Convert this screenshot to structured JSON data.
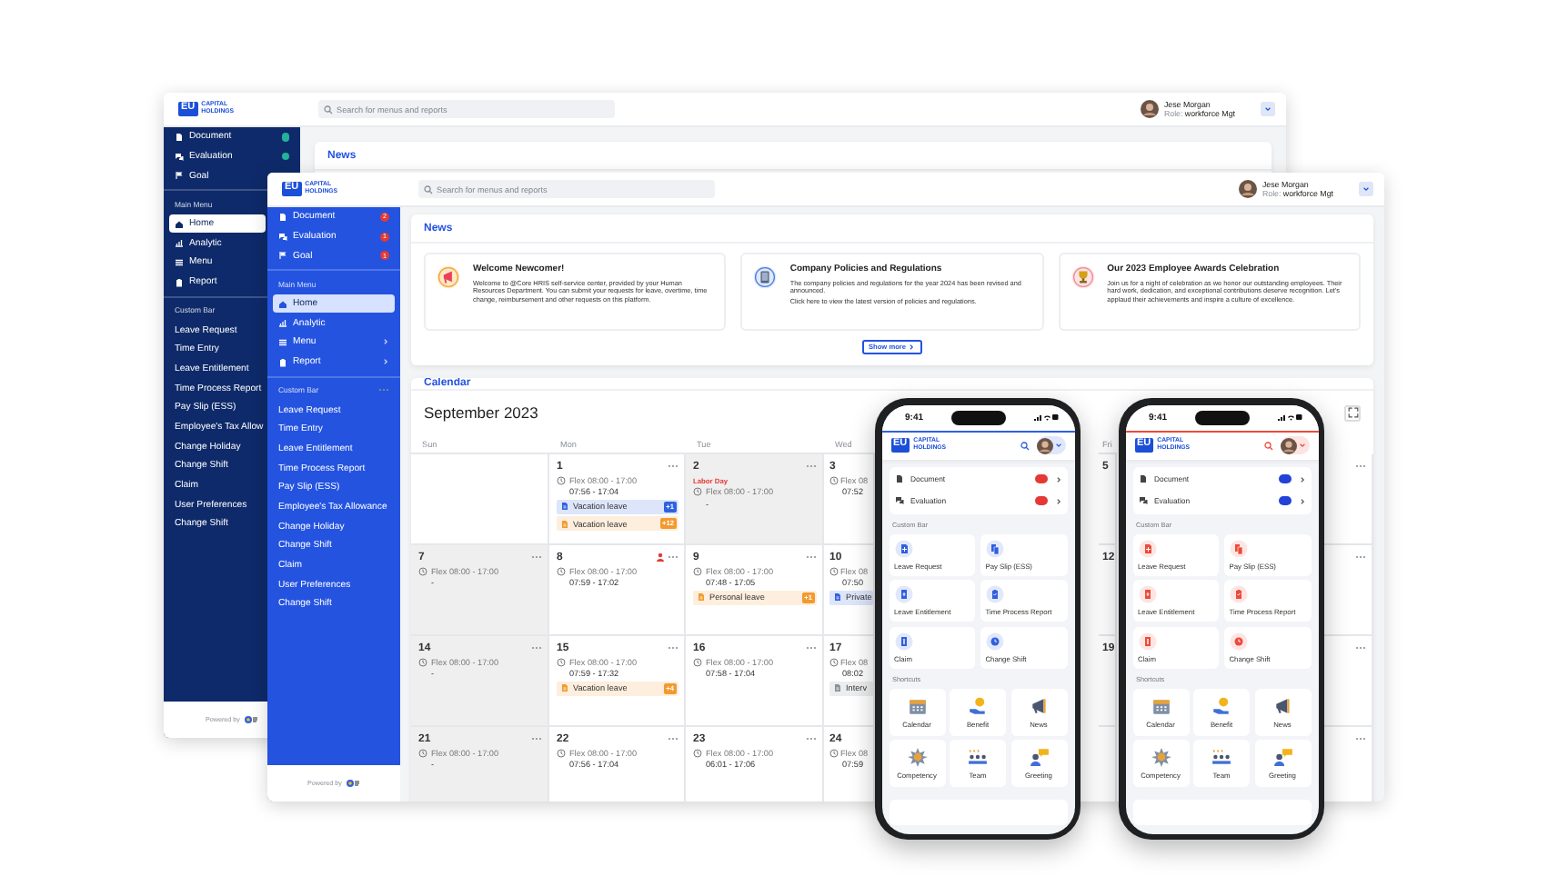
{
  "windows": [
    {
      "color": "#0e2a6a",
      "logo": {
        "mark": "EU",
        "name": "CAPITAL HOLDINGS"
      },
      "search": {
        "placeholder": "Search for menus and reports"
      },
      "user": {
        "name": "Jese Morgan",
        "role_label": "Role:",
        "role": "workforce Mgt"
      },
      "sidebar": {
        "pinned": [
          {
            "label": "Document",
            "color": "#22b39a"
          },
          {
            "label": "Evaluation",
            "color": "#22b39a"
          },
          {
            "label": "Goal"
          }
        ],
        "main_title": "Main Menu",
        "main": [
          {
            "label": "Home",
            "selected": true
          },
          {
            "label": "Analytic",
            "selected": false
          },
          {
            "label": "Menu",
            "selected": false
          },
          {
            "label": "Report",
            "selected": false
          }
        ],
        "custom_title": "Custom Bar",
        "custom": [
          "Leave Request",
          "Time Entry",
          "Leave Entitlement",
          "Time Process Report",
          "Pay Slip (ESS)",
          "Employee's Tax Allow",
          "Change Holiday",
          "Change Shift",
          "Claim",
          "User Preferences",
          "Change Shift"
        ],
        "footer": "Powered by"
      },
      "news": {
        "title": "News"
      }
    },
    {
      "color": "#2453e0",
      "logo": {
        "mark": "EU",
        "name": "CAPITAL HOLDINGS"
      },
      "search": {
        "placeholder": "Search for menus and reports"
      },
      "user": {
        "name": "Jese Morgan",
        "role_label": "Role:",
        "role": "workforce Mgt"
      },
      "sidebar": {
        "pinned": [
          {
            "label": "Document",
            "color": "#e53935",
            "badge": "2"
          },
          {
            "label": "Evaluation",
            "color": "#e53935",
            "badge": "1"
          },
          {
            "label": "Goal",
            "color": "#e53935",
            "badge": "1"
          }
        ],
        "main_title": "Main Menu",
        "main": [
          {
            "label": "Home",
            "selected": true,
            "submenu": false
          },
          {
            "label": "Analytic",
            "selected": false,
            "submenu": false
          },
          {
            "label": "Menu",
            "selected": false,
            "submenu": true
          },
          {
            "label": "Report",
            "selected": false,
            "submenu": true
          }
        ],
        "custom_title": "Custom Bar",
        "custom_more": true,
        "custom": [
          "Leave Request",
          "Time Entry",
          "Leave Entitlement",
          "Time Process Report",
          "Pay Slip (ESS)",
          "Employee's Tax Allowance",
          "Change Holiday",
          "Change Shift",
          "Claim",
          "User Preferences",
          "Change Shift"
        ],
        "footer": "Powered by"
      },
      "news": {
        "title": "News",
        "cards": [
          {
            "title": "Welcome Newcomer!",
            "paragraphs": [
              "Welcome to @Core HRIS self-service center, provided by your Human Resources Department. You can submit your requests for leave, overtime, time change, reimbursement and other requests on this platform."
            ]
          },
          {
            "title": "Company Policies and Regulations",
            "paragraphs": [
              "The company policies and regulations for the year 2024 has been revised and announced.",
              "Click here to view the latest version of policies and regulations."
            ]
          },
          {
            "title": "Our 2023 Employee Awards Celebration",
            "paragraphs": [
              "Join us for a night of celebration as we honor our outstanding employees. Their hard work, dedication, and exceptional contributions deserve recognition. Let's applaud their achievements and inspire a culture of excellence."
            ]
          }
        ],
        "show_more": "Show more"
      },
      "calendar": {
        "title": "Calendar",
        "month": "September 2023",
        "weekdays": [
          "Sun",
          "Mon",
          "Tue",
          "Wed",
          "Fri"
        ],
        "weeks": [
          [
            {
              "shaded": false
            },
            {
              "day": "1",
              "shaded": false,
              "flex": "Flex 08:00 - 17:00",
              "times": "07:56 - 17:04",
              "leaves": [
                {
                  "label": "Vacation leave",
                  "count": "+1",
                  "color": "#2f62e0"
                },
                {
                  "label": "Vacation leave",
                  "count": "+12",
                  "color": "#f39a2e"
                }
              ],
              "menu": true
            },
            {
              "day": "2",
              "shaded": true,
              "holiday": "Labor Day",
              "flex": "Flex 08:00 - 17:00",
              "times": "-",
              "menu": true
            },
            {
              "day": "3",
              "shaded": false,
              "flex": "Flex 08",
              "times": "07:52"
            },
            {
              "day": "5",
              "shaded": false
            },
            {
              "shaded": false,
              "menu": true
            }
          ],
          [
            {
              "day": "7",
              "shaded": true,
              "flex": "Flex 08:00 - 17:00",
              "times": "-",
              "menu": true
            },
            {
              "day": "8",
              "shaded": false,
              "alert": true,
              "flex": "Flex 08:00 - 17:00",
              "times": "07:59 - 17:02",
              "menu": true
            },
            {
              "day": "9",
              "shaded": false,
              "flex": "Flex 08:00 - 17:00",
              "times": "07:48 - 17:05",
              "leaves": [
                {
                  "label": "Personal leave",
                  "count": "+1",
                  "color": "#f39a2e"
                }
              ],
              "menu": true
            },
            {
              "day": "10",
              "shaded": false,
              "flex": "Flex 08",
              "times": "07:50",
              "leaves": [
                {
                  "label": "Private",
                  "color": "#2f62e0"
                }
              ]
            },
            {
              "day": "12",
              "shaded": false
            },
            {
              "shaded": false,
              "menu": true
            }
          ],
          [
            {
              "day": "14",
              "shaded": true,
              "flex": "Flex 08:00 - 17:00",
              "times": "-",
              "menu": true
            },
            {
              "day": "15",
              "shaded": false,
              "flex": "Flex 08:00 - 17:00",
              "times": "07:59 - 17:32",
              "leaves": [
                {
                  "label": "Vacation leave",
                  "count": "+4",
                  "color": "#f39a2e"
                }
              ],
              "menu": true
            },
            {
              "day": "16",
              "shaded": false,
              "flex": "Flex 08:00 - 17:00",
              "times": "07:58 - 17:04",
              "menu": true
            },
            {
              "day": "17",
              "shaded": false,
              "flex": "Flex 08",
              "times": "08:02",
              "leaves": [
                {
                  "label": "Interv",
                  "color": "#8a8f99"
                }
              ]
            },
            {
              "day": "19",
              "shaded": false
            },
            {
              "shaded": false,
              "menu": true
            }
          ],
          [
            {
              "day": "21",
              "shaded": true,
              "flex": "Flex 08:00 - 17:00",
              "times": "-",
              "menu": true
            },
            {
              "day": "22",
              "shaded": false,
              "flex": "Flex 08:00 - 17:00",
              "times": "07:56 - 17:04",
              "menu": true
            },
            {
              "day": "23",
              "shaded": false,
              "flex": "Flex 08:00 - 17:00",
              "times": "06:01 - 17:06",
              "menu": true
            },
            {
              "day": "24",
              "shaded": false,
              "flex": "Flex 08",
              "times": "07:59"
            },
            {
              "shaded": false
            },
            {
              "shaded": false,
              "menu": true
            }
          ]
        ]
      }
    }
  ],
  "phones": [
    {
      "color": "#2f5fe0",
      "time": "9:41",
      "logo": {
        "mark": "EU",
        "name": "CAPITAL HOLDINGS"
      },
      "pinned": [
        {
          "label": "Document",
          "color": "#e53935"
        },
        {
          "label": "Evaluation",
          "color": "#e53935"
        }
      ],
      "custom_title": "Custom Bar",
      "custom": [
        "Leave Request",
        "Pay Slip (ESS)",
        "Leave Entitlement",
        "Time Process Report",
        "Claim",
        "Change Shift"
      ],
      "shortcuts_title": "Shortcuts",
      "shortcuts": [
        "Calendar",
        "Benefit",
        "News",
        "Competency",
        "Team",
        "Greeting"
      ]
    },
    {
      "color": "#ee4a3a",
      "time": "9:41",
      "logo": {
        "mark": "EU",
        "name": "CAPITAL HOLDINGS"
      },
      "pinned": [
        {
          "label": "Document",
          "color": "#2343d8"
        },
        {
          "label": "Evaluation",
          "color": "#2343d8"
        }
      ],
      "custom_title": "Custom Bar",
      "custom": [
        "Leave Request",
        "Pay Slip (ESS)",
        "Leave Entitlement",
        "Time Process Report",
        "Claim",
        "Change Shift"
      ],
      "shortcuts_title": "Shortcuts",
      "shortcuts": [
        "Calendar",
        "Benefit",
        "News",
        "Competency",
        "Team",
        "Greeting"
      ]
    }
  ]
}
